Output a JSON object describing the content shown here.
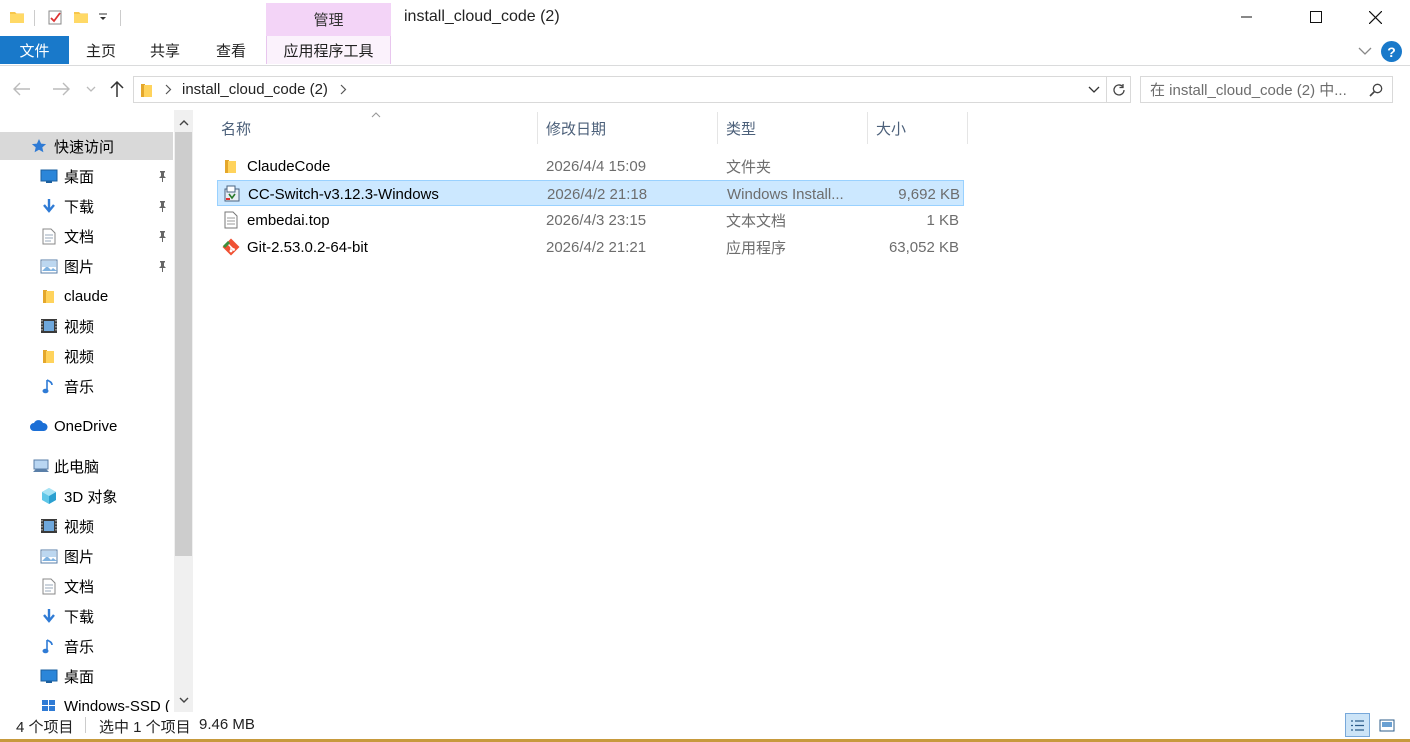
{
  "window": {
    "title": "install_cloud_code (2)",
    "context_tab_header": "管理",
    "accent": "#1979ca",
    "context_color": "#f3d4f7"
  },
  "ribbon": {
    "tabs": [
      {
        "label": "文件"
      },
      {
        "label": "主页"
      },
      {
        "label": "共享"
      },
      {
        "label": "查看"
      },
      {
        "label": "应用程序工具"
      }
    ]
  },
  "address": {
    "path": "install_cloud_code (2)",
    "search_placeholder": "在 install_cloud_code (2) 中..."
  },
  "nav": {
    "quick_access": "快速访问",
    "quick_items": [
      {
        "label": "桌面",
        "icon": "desktop-icon"
      },
      {
        "label": "下载",
        "icon": "download-icon"
      },
      {
        "label": "文档",
        "icon": "document-icon"
      },
      {
        "label": "图片",
        "icon": "picture-icon"
      },
      {
        "label": "claude",
        "icon": "folder-icon"
      },
      {
        "label": "视频",
        "icon": "video-icon"
      },
      {
        "label": "视频",
        "icon": "folder-icon"
      },
      {
        "label": "音乐",
        "icon": "music-icon"
      }
    ],
    "onedrive": "OneDrive",
    "this_pc": "此电脑",
    "pc_items": [
      {
        "label": "3D 对象",
        "icon": "cube-icon"
      },
      {
        "label": "视频",
        "icon": "video-icon"
      },
      {
        "label": "图片",
        "icon": "picture-icon"
      },
      {
        "label": "文档",
        "icon": "document-icon"
      },
      {
        "label": "下载",
        "icon": "download-icon"
      },
      {
        "label": "音乐",
        "icon": "music-icon"
      },
      {
        "label": "桌面",
        "icon": "desktop-icon"
      },
      {
        "label": "Windows-SSD (",
        "icon": "drive-icon"
      }
    ]
  },
  "columns": {
    "name": "名称",
    "date": "修改日期",
    "type": "类型",
    "size": "大小"
  },
  "files": [
    {
      "name": "ClaudeCode",
      "date": "2026/4/4 15:09",
      "type": "文件夹",
      "size": "",
      "icon": "folder-icon",
      "selected": false
    },
    {
      "name": "CC-Switch-v3.12.3-Windows",
      "date": "2026/4/2 21:18",
      "type": "Windows Install...",
      "size": "9,692 KB",
      "icon": "installer-icon",
      "selected": true
    },
    {
      "name": "embedai.top",
      "date": "2026/4/3 23:15",
      "type": "文本文档",
      "size": "1 KB",
      "icon": "text-file-icon",
      "selected": false
    },
    {
      "name": "Git-2.53.0.2-64-bit",
      "date": "2026/4/2 21:21",
      "type": "应用程序",
      "size": "63,052 KB",
      "icon": "git-icon",
      "selected": false
    }
  ],
  "status": {
    "count": "4 个项目",
    "selected": "选中 1 个项目",
    "size": "9.46 MB"
  }
}
